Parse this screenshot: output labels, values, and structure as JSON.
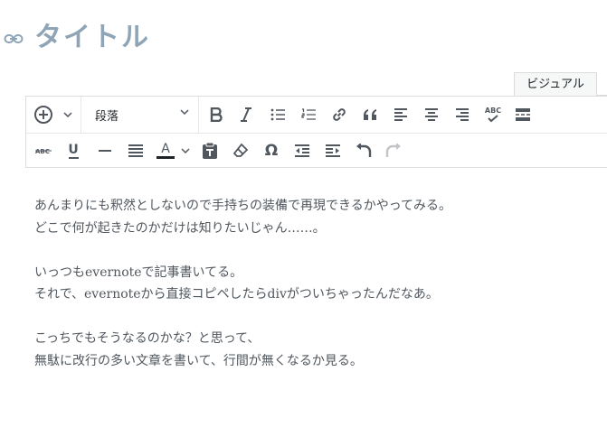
{
  "post": {
    "title": "タイトル",
    "view_tab": "ビジュアル"
  },
  "toolbar": {
    "format_select": "段落",
    "row1": [
      "add-block-icon",
      "chevron-down-icon",
      "bold-icon",
      "italic-icon",
      "bullet-list-icon",
      "numbered-list-icon",
      "link-icon",
      "blockquote-icon",
      "align-left-icon",
      "align-center-icon",
      "align-right-icon",
      "spellcheck-icon",
      "read-more-icon"
    ],
    "row2": [
      "strikethrough-icon",
      "underline-icon",
      "horizontal-rule-icon",
      "justify-icon",
      "text-color-icon",
      "paste-as-text-icon",
      "clear-formatting-icon",
      "special-character-icon",
      "outdent-icon",
      "indent-icon",
      "undo-icon",
      "redo-icon"
    ],
    "spellcheck_glyph": "ABC",
    "text_color_glyph": "A",
    "underline_glyph": "U",
    "omega_glyph": "Ω"
  },
  "content": {
    "paragraphs": [
      [
        "あんまりにも釈然としないので手持ちの装備で再現できるかやってみる。",
        "どこで何が起きたのかだけは知りたいじゃん……。"
      ],
      [
        "いっつもevernoteで記事書いてる。",
        "それで、evernoteから直接コピペしたらdivがついちゃったんだなあ。"
      ],
      [
        "こっちでもそうなるのかな？と思って、",
        "無駄に改行の多い文章を書いて、行間が無くなるか見る。"
      ]
    ]
  },
  "colors": {
    "title": "#8fa5b6",
    "icon": "#50575e",
    "disabled": "#c3c4c7",
    "border": "#dcdcde",
    "text_color_underline": "#1d2327"
  }
}
